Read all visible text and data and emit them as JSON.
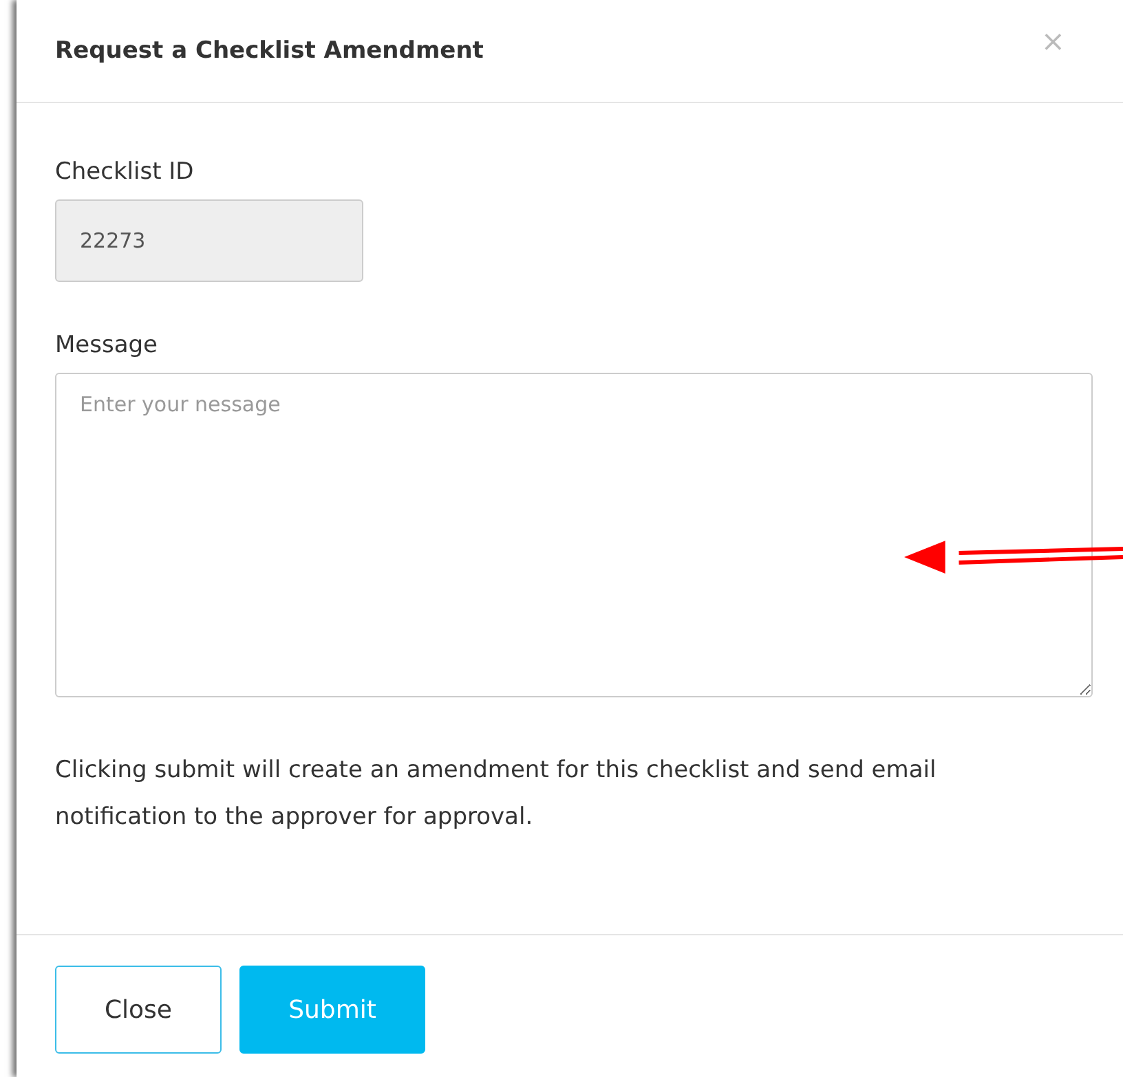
{
  "dialog": {
    "title": "Request a Checklist Amendment",
    "close_icon": "×"
  },
  "fields": [
    {
      "kind": "input",
      "label": "Checklist ID",
      "value": "22273",
      "readonly": true
    },
    {
      "kind": "textarea",
      "label": "Message",
      "placeholder": "Enter your nessage",
      "readonly": false
    }
  ],
  "notice": "Clicking submit will create an amendment for this checklist and send email notification to the approver for approval.",
  "buttons": [
    {
      "label": "Close",
      "kind": "secondary"
    },
    {
      "label": "Submit",
      "kind": "primary"
    }
  ]
}
